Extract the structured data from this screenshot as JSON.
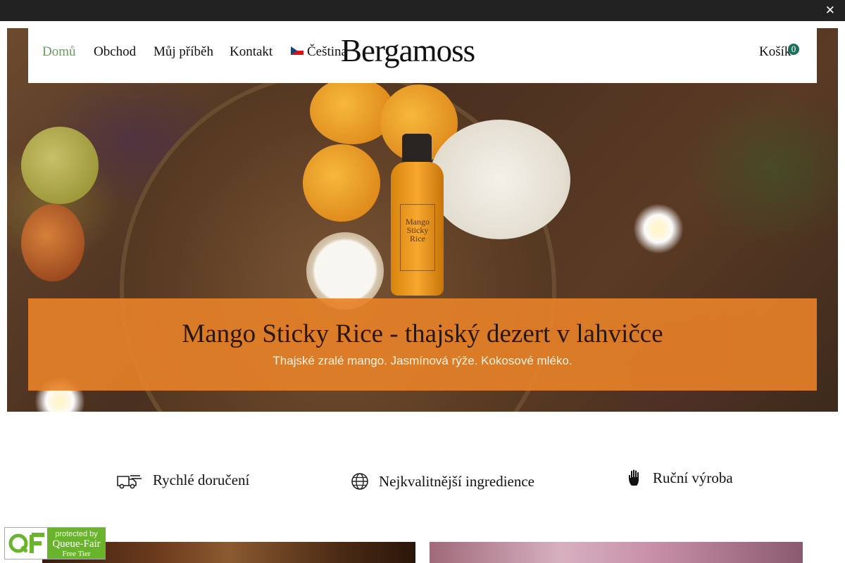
{
  "notice_bar": {
    "close_icon": "close-icon",
    "close_glyph": "✕"
  },
  "nav": {
    "items": [
      {
        "label": "Domů",
        "active": true
      },
      {
        "label": "Obchod",
        "active": false
      },
      {
        "label": "Můj příběh",
        "active": false
      },
      {
        "label": "Kontakt",
        "active": false
      }
    ],
    "language": {
      "label": "Čeština",
      "flag_icon": "czech-flag-icon"
    },
    "logo": "Bergamoss",
    "cart": {
      "label": "Košík",
      "count": "0"
    }
  },
  "hero": {
    "title": "Mango Sticky Rice - thajský dezert v lahvičce",
    "subtitle": "Thajské zralé mango. Jasmínová rýže. Kokosové mléko.",
    "bottle_label": "Mango Sticky Rice",
    "caption_color": "#e88228"
  },
  "features": [
    {
      "label": "Rychlé doručení",
      "icon": "delivery-truck-icon"
    },
    {
      "label": "Nejkvalitnější ingredience",
      "icon": "globe-icon"
    },
    {
      "label": "Ruční výroba",
      "icon": "hand-icon"
    }
  ],
  "badge": {
    "protected_by": "protected by",
    "name": "Queue-Fair",
    "tier": "Free Tier",
    "logo_text": "QF",
    "accent_color": "#6ab42d"
  },
  "colors": {
    "active_nav": "#6c9a63",
    "cart_badge": "#1e6f5a",
    "notice_bar": "#222222"
  }
}
